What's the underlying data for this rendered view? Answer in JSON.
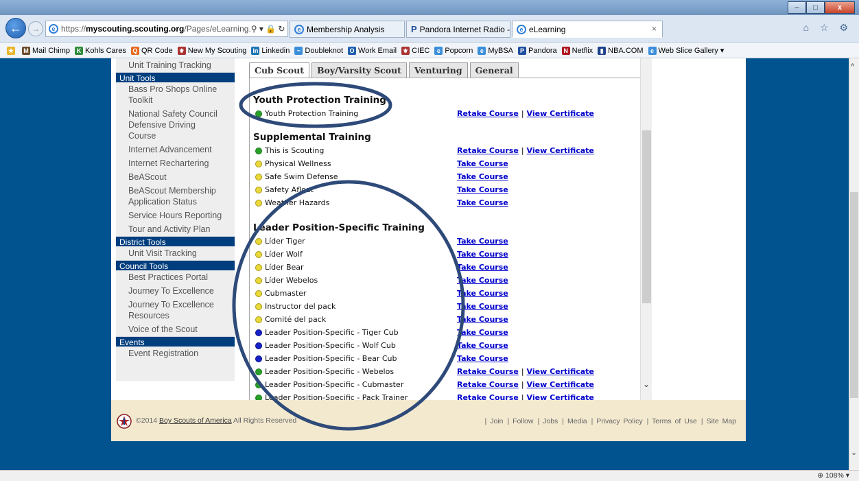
{
  "browser": {
    "address": {
      "prefix": "https://",
      "domain": "myscouting.scouting.org",
      "path": "/Pages/eLearning.",
      "controls": "⚲ ▾ 🔒 ↻"
    },
    "tabs": [
      {
        "label": "Membership Analysis",
        "icon": "ie-icon"
      },
      {
        "label": "Pandora Internet Radio - Listen...",
        "icon": "pandora-icon"
      },
      {
        "label": "eLearning",
        "icon": "ie-icon",
        "active": true
      }
    ],
    "window_buttons": {
      "minimize": "–",
      "maximize": "□",
      "close": "x"
    },
    "right_icons": "⌂ ☆ ⚙",
    "favorites": [
      "Mail Chimp",
      "Kohls Cares",
      "QR Code",
      "New My Scouting",
      "Linkedin",
      "Doubleknot",
      "Work Email",
      "CIEC",
      "Popcorn",
      "MyBSA",
      "Pandora",
      "Netflix",
      "NBA.COM",
      "Web Slice Gallery ▾"
    ],
    "zoom": "108%"
  },
  "sidebar": {
    "top_item": "Unit Training Tracking",
    "sections": [
      {
        "title": "Unit Tools",
        "items": [
          "Bass Pro Shops Online Toolkit",
          "National Safety Council Defensive Driving Course",
          "Internet Advancement",
          "Internet Rechartering",
          "BeAScout",
          "BeAScout Membership Application Status",
          "Service Hours Reporting",
          "Tour and Activity Plan"
        ]
      },
      {
        "title": "District Tools",
        "items": [
          "Unit Visit Tracking"
        ]
      },
      {
        "title": "Council Tools",
        "items": [
          "Best Practices Portal",
          "Journey To Excellence",
          "Journey To Excellence Resources",
          "Voice of the Scout"
        ]
      },
      {
        "title": "Events",
        "items": [
          "Event Registration"
        ]
      }
    ]
  },
  "content": {
    "tabs": [
      "Cub Scout",
      "Boy/Varsity Scout",
      "Venturing",
      "General"
    ],
    "link_labels": {
      "retake": "Retake Course",
      "view": "View Certificate",
      "take": "Take Course",
      "sep": "|"
    },
    "sections": [
      {
        "title": "Youth Protection Training",
        "courses": [
          {
            "name": "Youth Protection Training",
            "status": "green",
            "links": "retake-view"
          }
        ]
      },
      {
        "title": "Supplemental Training",
        "courses": [
          {
            "name": "This is Scouting",
            "status": "green",
            "links": "retake-view"
          },
          {
            "name": "Physical Wellness",
            "status": "yellow",
            "links": "take"
          },
          {
            "name": "Safe Swim Defense",
            "status": "yellow",
            "links": "take"
          },
          {
            "name": "Safety Afloat",
            "status": "yellow",
            "links": "take"
          },
          {
            "name": "Weather Hazards",
            "status": "yellow",
            "links": "take"
          }
        ]
      },
      {
        "title": "Leader Position-Specific Training",
        "courses": [
          {
            "name": "Líder Tiger",
            "status": "yellow",
            "links": "take"
          },
          {
            "name": "Líder Wolf",
            "status": "yellow",
            "links": "take"
          },
          {
            "name": "Líder Bear",
            "status": "yellow",
            "links": "take"
          },
          {
            "name": "Líder Webelos",
            "status": "yellow",
            "links": "take"
          },
          {
            "name": "Cubmaster",
            "status": "yellow",
            "links": "take"
          },
          {
            "name": "Instructor del pack",
            "status": "yellow",
            "links": "take"
          },
          {
            "name": "Comité del pack",
            "status": "yellow",
            "links": "take"
          },
          {
            "name": "Leader Position-Specific - Tiger Cub",
            "status": "blue",
            "links": "take"
          },
          {
            "name": "Leader Position-Specific - Wolf Cub",
            "status": "blue",
            "links": "take"
          },
          {
            "name": "Leader Position-Specific - Bear Cub",
            "status": "blue",
            "links": "take"
          },
          {
            "name": "Leader Position-Specific - Webelos",
            "status": "green",
            "links": "retake-view"
          },
          {
            "name": "Leader Position-Specific - Cubmaster",
            "status": "green",
            "links": "retake-view"
          },
          {
            "name": "Leader Position-Specific - Pack Trainer",
            "status": "green",
            "links": "retake-view"
          }
        ]
      }
    ]
  },
  "footer": {
    "copyright": "©2014",
    "org_link": "Boy Scouts of America",
    "rights": "All Rights Reserved",
    "links": [
      "Join",
      "Follow",
      "Jobs",
      "Media",
      "Privacy Policy",
      "Terms of Use",
      "Site Map"
    ]
  },
  "colors": {
    "page_bg": "#00538f",
    "section_header": "#003e7e",
    "annotation": "#2e4a79",
    "link": "#0000cc"
  }
}
